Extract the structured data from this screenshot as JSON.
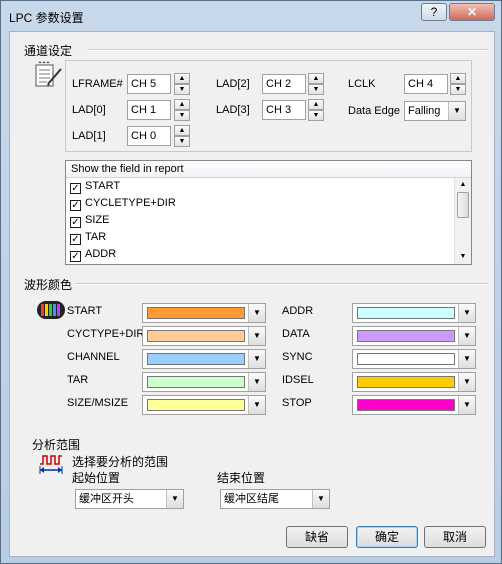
{
  "window": {
    "title": "LPC 参数设置",
    "help_label": "?",
    "close_label": "✕"
  },
  "channel": {
    "section_title": "通道设定",
    "fields": [
      {
        "label": "LFRAME#",
        "value": "CH 5"
      },
      {
        "label": "LAD[0]",
        "value": "CH 1"
      },
      {
        "label": "LAD[1]",
        "value": "CH 0"
      },
      {
        "label": "LAD[2]",
        "value": "CH 2"
      },
      {
        "label": "LAD[3]",
        "value": "CH 3"
      },
      {
        "label": "LCLK",
        "value": "CH 4"
      }
    ],
    "data_edge": {
      "label": "Data Edge",
      "value": "Falling"
    },
    "report_list": {
      "header": "Show the field in report",
      "items": [
        {
          "label": "START",
          "checked": true
        },
        {
          "label": "CYCLETYPE+DIR",
          "checked": true
        },
        {
          "label": "SIZE",
          "checked": true
        },
        {
          "label": "TAR",
          "checked": true
        },
        {
          "label": "ADDR",
          "checked": true
        }
      ]
    }
  },
  "colors": {
    "section_title": "波形颜色",
    "items": [
      {
        "label": "START",
        "color": "#ff9933"
      },
      {
        "label": "CYCTYPE+DIR",
        "color": "#ffcc99"
      },
      {
        "label": "CHANNEL",
        "color": "#99ccff"
      },
      {
        "label": "TAR",
        "color": "#ccffcc"
      },
      {
        "label": "SIZE/MSIZE",
        "color": "#ffff99"
      },
      {
        "label": "ADDR",
        "color": "#ccffff"
      },
      {
        "label": "DATA",
        "color": "#cc99ff"
      },
      {
        "label": "SYNC",
        "color": "#ffffff"
      },
      {
        "label": "IDSEL",
        "color": "#ffcc00"
      },
      {
        "label": "STOP",
        "color": "#ff00cc"
      }
    ]
  },
  "range": {
    "section_title": "分析范围",
    "description": "选择要分析的范围",
    "start_label": "起始位置",
    "start_value": "缓冲区开头",
    "end_label": "结束位置",
    "end_value": "缓冲区结尾"
  },
  "buttons": {
    "default_label": "缺省",
    "ok_label": "确定",
    "cancel_label": "取消"
  }
}
